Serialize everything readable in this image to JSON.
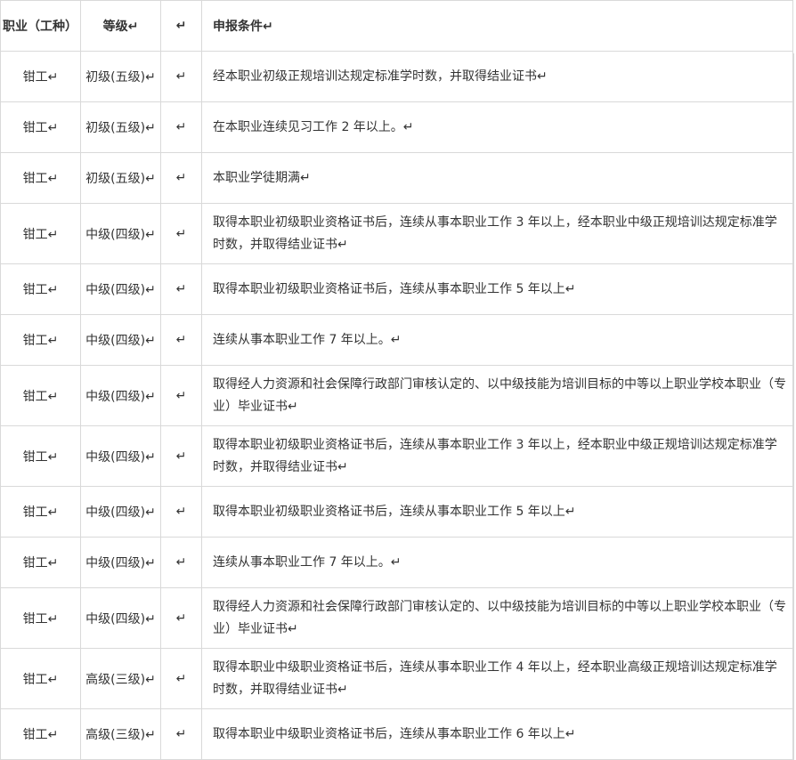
{
  "table": {
    "headers": {
      "occupation": "职业（工种）",
      "level": "等级↵",
      "blank": "↵",
      "condition": "申报条件↵"
    },
    "rows": [
      {
        "occupation": "钳工↵",
        "level": "初级(五级)↵",
        "blank": "↵",
        "condition": "经本职业初级正规培训达规定标准学时数，并取得结业证书↵",
        "lines": 1
      },
      {
        "occupation": "钳工↵",
        "level": "初级(五级)↵",
        "blank": "↵",
        "condition": "在本职业连续见习工作 2 年以上。↵",
        "lines": 1
      },
      {
        "occupation": "钳工↵",
        "level": "初级(五级)↵",
        "blank": "↵",
        "condition": "本职业学徒期满↵",
        "lines": 1
      },
      {
        "occupation": "钳工↵",
        "level": "中级(四级)↵",
        "blank": "↵",
        "condition": "取得本职业初级职业资格证书后，连续从事本职业工作 3 年以上，经本职业中级正规培训达规定标准学时数，并取得结业证书↵",
        "lines": 2
      },
      {
        "occupation": "钳工↵",
        "level": "中级(四级)↵",
        "blank": "↵",
        "condition": "取得本职业初级职业资格证书后，连续从事本职业工作 5 年以上↵",
        "lines": 1
      },
      {
        "occupation": "钳工↵",
        "level": "中级(四级)↵",
        "blank": "↵",
        "condition": "连续从事本职业工作 7 年以上。↵",
        "lines": 1
      },
      {
        "occupation": "钳工↵",
        "level": "中级(四级)↵",
        "blank": "↵",
        "condition": "取得经人力资源和社会保障行政部门审核认定的、以中级技能为培训目标的中等以上职业学校本职业（专业）毕业证书↵",
        "lines": 2
      },
      {
        "occupation": "钳工↵",
        "level": "中级(四级)↵",
        "blank": "↵",
        "condition": "取得本职业初级职业资格证书后，连续从事本职业工作 3 年以上，经本职业中级正规培训达规定标准学时数，并取得结业证书↵",
        "lines": 2
      },
      {
        "occupation": "钳工↵",
        "level": "中级(四级)↵",
        "blank": "↵",
        "condition": "取得本职业初级职业资格证书后，连续从事本职业工作 5 年以上↵",
        "lines": 1
      },
      {
        "occupation": "钳工↵",
        "level": "中级(四级)↵",
        "blank": "↵",
        "condition": "连续从事本职业工作 7 年以上。↵",
        "lines": 1
      },
      {
        "occupation": "钳工↵",
        "level": "中级(四级)↵",
        "blank": "↵",
        "condition": "取得经人力资源和社会保障行政部门审核认定的、以中级技能为培训目标的中等以上职业学校本职业（专业）毕业证书↵",
        "lines": 2
      },
      {
        "occupation": "钳工↵",
        "level": "高级(三级)↵",
        "blank": "↵",
        "condition": "取得本职业中级职业资格证书后，连续从事本职业工作 4 年以上，经本职业高级正规培训达规定标准学时数，并取得结业证书↵",
        "lines": 2
      },
      {
        "occupation": "钳工↵",
        "level": "高级(三级)↵",
        "blank": "↵",
        "condition": "取得本职业中级职业资格证书后，连续从事本职业工作 6 年以上↵",
        "lines": 1
      }
    ]
  },
  "colors": {
    "border": "#d9d9d9",
    "text": "#333333"
  }
}
